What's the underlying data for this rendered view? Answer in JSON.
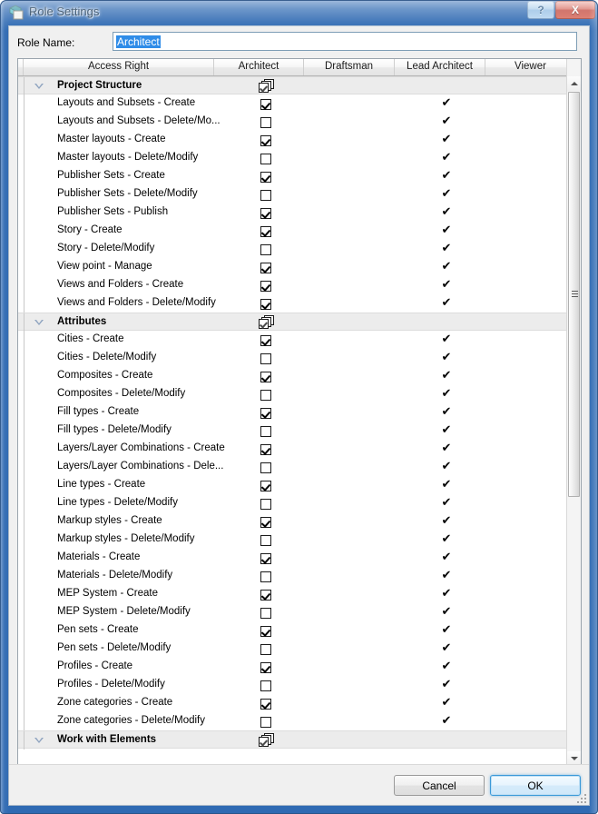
{
  "window": {
    "title": "Role Settings",
    "icon": "role-settings-icon",
    "help_label": "?",
    "close_label": "X"
  },
  "form": {
    "role_name_label": "Role Name:",
    "role_name_value": "Architect",
    "role_name_placeholder": ""
  },
  "grid": {
    "columns": [
      {
        "key": "spacer",
        "label": ""
      },
      {
        "key": "access_right",
        "label": "Access Right"
      },
      {
        "key": "architect",
        "label": "Architect"
      },
      {
        "key": "draftsman",
        "label": "Draftsman"
      },
      {
        "key": "lead_architect",
        "label": "Lead Architect"
      },
      {
        "key": "viewer",
        "label": "Viewer"
      }
    ],
    "rows": [
      {
        "type": "group",
        "label": "Project Structure",
        "expanded": true,
        "architect": "mixed",
        "draftsman": false,
        "lead_architect": false,
        "viewer": false
      },
      {
        "type": "item",
        "label": "Layouts and Subsets - Create",
        "architect": true,
        "draftsman": false,
        "lead_architect": true,
        "viewer": false
      },
      {
        "type": "item",
        "label": "Layouts and Subsets - Delete/Mo...",
        "architect": false,
        "draftsman": false,
        "lead_architect": true,
        "viewer": false
      },
      {
        "type": "item",
        "label": "Master layouts - Create",
        "architect": true,
        "draftsman": false,
        "lead_architect": true,
        "viewer": false
      },
      {
        "type": "item",
        "label": "Master layouts - Delete/Modify",
        "architect": false,
        "draftsman": false,
        "lead_architect": true,
        "viewer": false
      },
      {
        "type": "item",
        "label": "Publisher Sets - Create",
        "architect": true,
        "draftsman": false,
        "lead_architect": true,
        "viewer": false
      },
      {
        "type": "item",
        "label": "Publisher Sets - Delete/Modify",
        "architect": false,
        "draftsman": false,
        "lead_architect": true,
        "viewer": false
      },
      {
        "type": "item",
        "label": "Publisher Sets - Publish",
        "architect": true,
        "draftsman": false,
        "lead_architect": true,
        "viewer": false
      },
      {
        "type": "item",
        "label": "Story - Create",
        "architect": true,
        "draftsman": false,
        "lead_architect": true,
        "viewer": false
      },
      {
        "type": "item",
        "label": "Story - Delete/Modify",
        "architect": false,
        "draftsman": false,
        "lead_architect": true,
        "viewer": false
      },
      {
        "type": "item",
        "label": "View point - Manage",
        "architect": true,
        "draftsman": false,
        "lead_architect": true,
        "viewer": false
      },
      {
        "type": "item",
        "label": "Views and Folders - Create",
        "architect": true,
        "draftsman": false,
        "lead_architect": true,
        "viewer": false
      },
      {
        "type": "item",
        "label": "Views and Folders - Delete/Modify",
        "architect": true,
        "draftsman": false,
        "lead_architect": true,
        "viewer": false
      },
      {
        "type": "group",
        "label": "Attributes",
        "expanded": true,
        "architect": "mixed",
        "draftsman": false,
        "lead_architect": false,
        "viewer": false
      },
      {
        "type": "item",
        "label": "Cities - Create",
        "architect": true,
        "draftsman": false,
        "lead_architect": true,
        "viewer": false
      },
      {
        "type": "item",
        "label": "Cities - Delete/Modify",
        "architect": false,
        "draftsman": false,
        "lead_architect": true,
        "viewer": false
      },
      {
        "type": "item",
        "label": "Composites - Create",
        "architect": true,
        "draftsman": false,
        "lead_architect": true,
        "viewer": false
      },
      {
        "type": "item",
        "label": "Composites - Delete/Modify",
        "architect": false,
        "draftsman": false,
        "lead_architect": true,
        "viewer": false
      },
      {
        "type": "item",
        "label": "Fill types - Create",
        "architect": true,
        "draftsman": false,
        "lead_architect": true,
        "viewer": false
      },
      {
        "type": "item",
        "label": "Fill types - Delete/Modify",
        "architect": false,
        "draftsman": false,
        "lead_architect": true,
        "viewer": false
      },
      {
        "type": "item",
        "label": "Layers/Layer Combinations - Create",
        "architect": true,
        "draftsman": false,
        "lead_architect": true,
        "viewer": false
      },
      {
        "type": "item",
        "label": "Layers/Layer Combinations - Dele...",
        "architect": false,
        "draftsman": false,
        "lead_architect": true,
        "viewer": false
      },
      {
        "type": "item",
        "label": "Line types - Create",
        "architect": true,
        "draftsman": false,
        "lead_architect": true,
        "viewer": false
      },
      {
        "type": "item",
        "label": "Line types - Delete/Modify",
        "architect": false,
        "draftsman": false,
        "lead_architect": true,
        "viewer": false
      },
      {
        "type": "item",
        "label": "Markup styles - Create",
        "architect": true,
        "draftsman": false,
        "lead_architect": true,
        "viewer": false
      },
      {
        "type": "item",
        "label": "Markup styles - Delete/Modify",
        "architect": false,
        "draftsman": false,
        "lead_architect": true,
        "viewer": false
      },
      {
        "type": "item",
        "label": "Materials - Create",
        "architect": true,
        "draftsman": false,
        "lead_architect": true,
        "viewer": false
      },
      {
        "type": "item",
        "label": "Materials - Delete/Modify",
        "architect": false,
        "draftsman": false,
        "lead_architect": true,
        "viewer": false
      },
      {
        "type": "item",
        "label": "MEP System - Create",
        "architect": true,
        "draftsman": false,
        "lead_architect": true,
        "viewer": false
      },
      {
        "type": "item",
        "label": "MEP System - Delete/Modify",
        "architect": false,
        "draftsman": false,
        "lead_architect": true,
        "viewer": false
      },
      {
        "type": "item",
        "label": "Pen sets - Create",
        "architect": true,
        "draftsman": false,
        "lead_architect": true,
        "viewer": false
      },
      {
        "type": "item",
        "label": "Pen sets - Delete/Modify",
        "architect": false,
        "draftsman": false,
        "lead_architect": true,
        "viewer": false
      },
      {
        "type": "item",
        "label": "Profiles - Create",
        "architect": true,
        "draftsman": false,
        "lead_architect": true,
        "viewer": false
      },
      {
        "type": "item",
        "label": "Profiles - Delete/Modify",
        "architect": false,
        "draftsman": false,
        "lead_architect": true,
        "viewer": false
      },
      {
        "type": "item",
        "label": "Zone categories - Create",
        "architect": true,
        "draftsman": false,
        "lead_architect": true,
        "viewer": false
      },
      {
        "type": "item",
        "label": "Zone categories - Delete/Modify",
        "architect": false,
        "draftsman": false,
        "lead_architect": true,
        "viewer": false
      },
      {
        "type": "group",
        "label": "Work with Elements",
        "expanded": true,
        "architect": "mixed",
        "draftsman": false,
        "lead_architect": false,
        "viewer": false
      }
    ]
  },
  "footer": {
    "cancel_label": "Cancel",
    "ok_label": "OK"
  },
  "colors": {
    "accent": "#2f6ab3",
    "selection": "#2f8ce8",
    "default_button_border": "#3c9ad9",
    "group_row_bg": "#ececec",
    "close_button": "#bf3f33"
  }
}
